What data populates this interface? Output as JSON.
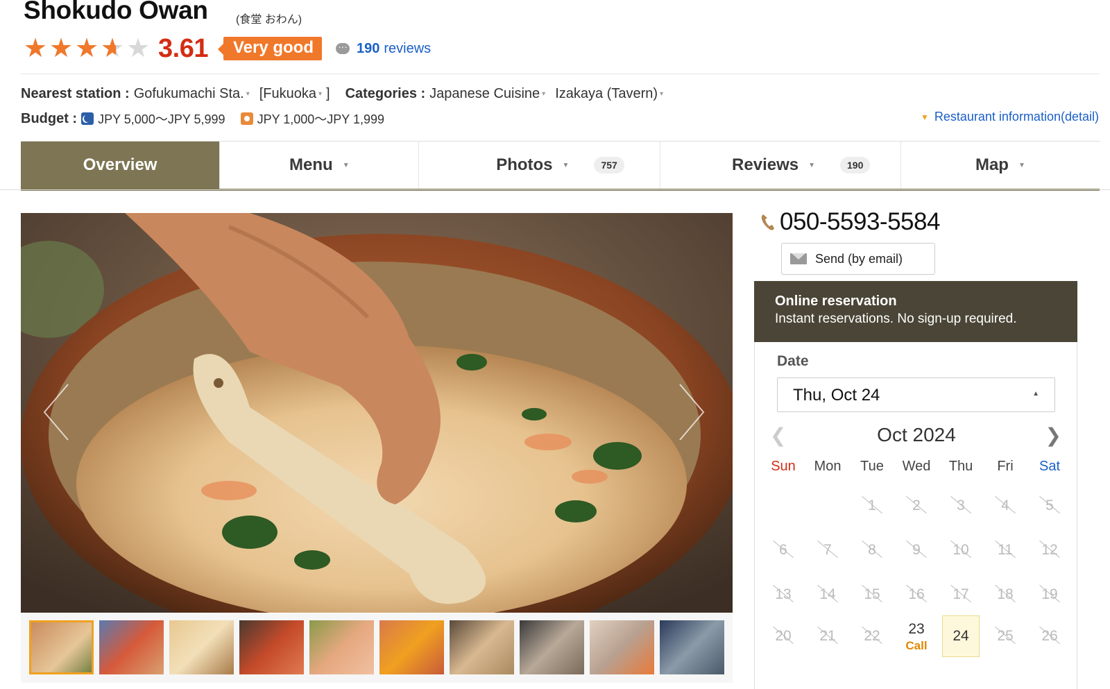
{
  "restaurant": {
    "name": "Shokudo Owan",
    "name_ja": "(食堂 おわん)",
    "rating_score": "3.61",
    "rating_value": 3.61,
    "rating_label": "Very good",
    "review_count": "190",
    "review_word": "reviews"
  },
  "info": {
    "station_label": "Nearest station :",
    "station": "Gofukumachi Sta.",
    "area_open": "[Fukuoka",
    "area_close": "]",
    "categories_label": "Categories :",
    "category1": "Japanese Cuisine",
    "category2": "Izakaya (Tavern)",
    "budget_label": "Budget :",
    "budget_dinner": "JPY 5,000～JPY 5,999",
    "budget_lunch": "JPY 1,000～JPY 1,999",
    "detail_link": "Restaurant information(detail)"
  },
  "tabs": [
    {
      "label": "Overview"
    },
    {
      "label": "Menu"
    },
    {
      "label": "Photos",
      "count": "757"
    },
    {
      "label": "Reviews",
      "count": "190"
    },
    {
      "label": "Map"
    }
  ],
  "contact": {
    "phone": "050-5593-5584",
    "send_label": "Send (by email)"
  },
  "reservation": {
    "title": "Online reservation",
    "subtitle": "Instant reservations. No sign-up required.",
    "date_label": "Date",
    "date_value": "Thu, Oct 24",
    "month": "Oct 2024",
    "weekdays": [
      "Sun",
      "Mon",
      "Tue",
      "Wed",
      "Thu",
      "Fri",
      "Sat"
    ],
    "call_label": "Call",
    "call_day": "23",
    "selected_day": "24",
    "days": [
      [
        "",
        "",
        "1",
        "2",
        "3",
        "4",
        "5"
      ],
      [
        "6",
        "7",
        "8",
        "9",
        "10",
        "11",
        "12"
      ],
      [
        "13",
        "14",
        "15",
        "16",
        "17",
        "18",
        "19"
      ],
      [
        "20",
        "21",
        "22",
        "23",
        "24",
        "25",
        "26"
      ]
    ]
  },
  "colors": {
    "accent_orange": "#f0782a",
    "score_red": "#d32d14",
    "tab_active": "#7d7553",
    "reservation_header": "#4a4536",
    "link_blue": "#1a5fc9"
  }
}
